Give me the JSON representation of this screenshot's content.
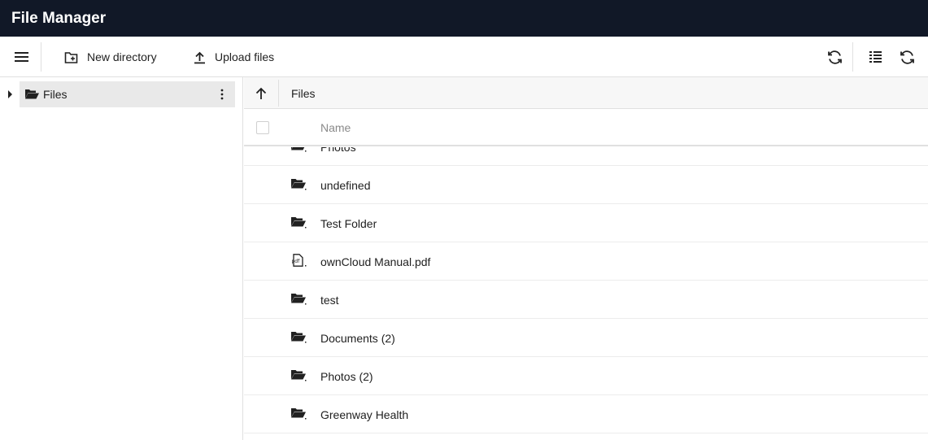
{
  "app": {
    "title": "File Manager"
  },
  "toolbar": {
    "menu_icon": "hamburger-icon",
    "new_directory_label": "New directory",
    "upload_files_label": "Upload files",
    "refresh_icon": "refresh-icon",
    "view_icon": "list-view-icon"
  },
  "sidebar": {
    "tree": [
      {
        "label": "Files",
        "icon": "folder-open-icon",
        "selected": true
      }
    ]
  },
  "main": {
    "breadcrumb": "Files",
    "column_name": "Name",
    "rows": [
      {
        "name": "Photos",
        "icon": "folder-icon"
      },
      {
        "name": "undefined",
        "icon": "folder-icon"
      },
      {
        "name": "Test Folder",
        "icon": "folder-icon"
      },
      {
        "name": "ownCloud Manual.pdf",
        "icon": "pdf-file-icon"
      },
      {
        "name": "test",
        "icon": "folder-icon"
      },
      {
        "name": "Documents (2)",
        "icon": "folder-icon"
      },
      {
        "name": "Photos (2)",
        "icon": "folder-icon"
      },
      {
        "name": "Greenway Health",
        "icon": "folder-icon"
      }
    ]
  }
}
